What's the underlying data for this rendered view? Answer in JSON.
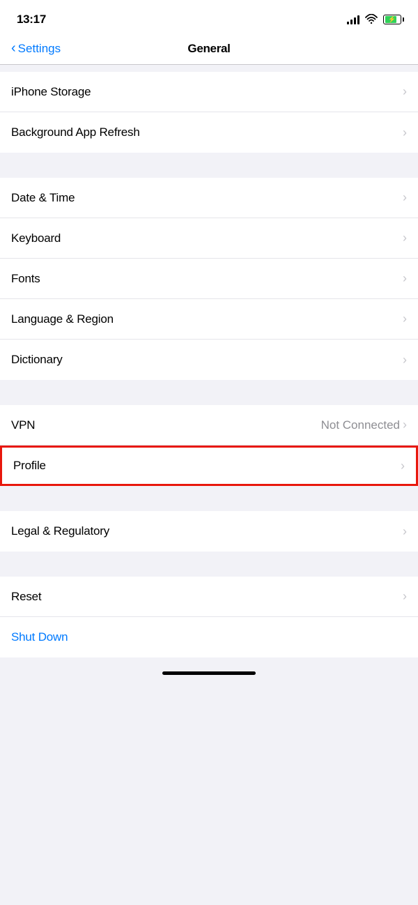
{
  "status": {
    "time": "13:17",
    "battery_color": "#30d158"
  },
  "nav": {
    "back_label": "Settings",
    "title": "General"
  },
  "sections": [
    {
      "id": "storage-refresh",
      "items": [
        {
          "id": "iphone-storage",
          "label": "iPhone Storage",
          "value": "",
          "chevron": true
        },
        {
          "id": "background-app-refresh",
          "label": "Background App Refresh",
          "value": "",
          "chevron": true
        }
      ]
    },
    {
      "id": "datetime-keyboard",
      "items": [
        {
          "id": "date-time",
          "label": "Date & Time",
          "value": "",
          "chevron": true
        },
        {
          "id": "keyboard",
          "label": "Keyboard",
          "value": "",
          "chevron": true
        },
        {
          "id": "fonts",
          "label": "Fonts",
          "value": "",
          "chevron": true
        },
        {
          "id": "language-region",
          "label": "Language & Region",
          "value": "",
          "chevron": true
        },
        {
          "id": "dictionary",
          "label": "Dictionary",
          "value": "",
          "chevron": true
        }
      ]
    },
    {
      "id": "vpn",
      "items": [
        {
          "id": "vpn",
          "label": "VPN",
          "value": "Not Connected",
          "chevron": true
        }
      ]
    },
    {
      "id": "profile",
      "highlighted": true,
      "items": [
        {
          "id": "profile",
          "label": "Profile",
          "value": "",
          "chevron": true
        }
      ]
    },
    {
      "id": "legal",
      "items": [
        {
          "id": "legal-regulatory",
          "label": "Legal & Regulatory",
          "value": "",
          "chevron": true
        }
      ]
    },
    {
      "id": "reset-shutdown",
      "items": [
        {
          "id": "reset",
          "label": "Reset",
          "value": "",
          "chevron": true
        },
        {
          "id": "shut-down",
          "label": "Shut Down",
          "value": "",
          "chevron": false,
          "blue": true
        }
      ]
    }
  ]
}
